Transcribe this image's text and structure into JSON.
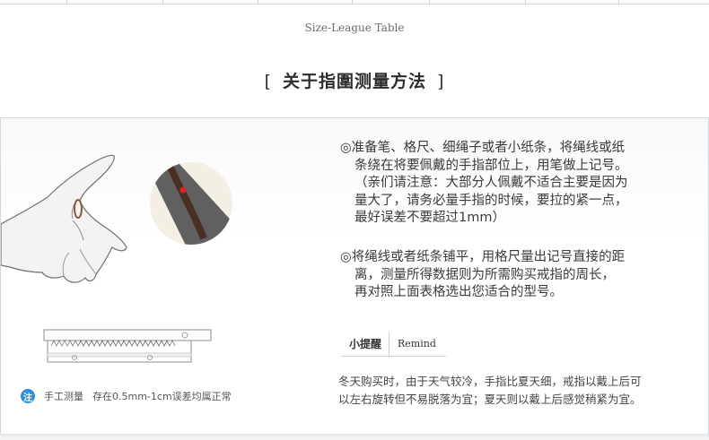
{
  "size_table": {
    "caption": "Size-League Table"
  },
  "section": {
    "bracket_open": "[",
    "title": "关于指圍测量方法",
    "bracket_close": "]"
  },
  "instructions": {
    "step1_lines": [
      "◎准备笔、格尺、细绳子或者小纸条，将绳线或纸",
      "条绕在将要佩戴的手指部位上，用笔做上记号。",
      "（亲们请注意：大部分人佩戴不适合主要是因为",
      "量大了，请务必量手指的时候，要拉的紧一点，",
      "最好误差不要超过1mm）"
    ],
    "step2_lines": [
      "◎将绳线或者纸条铺平，用格尺量出记号直接的距",
      "离，测量所得数据则为所需购买戒指的周长，",
      "再对照上面表格选出您适合的型号。"
    ]
  },
  "tip": {
    "label_zh": "小提醒",
    "label_en": "Remind",
    "note_lines": [
      "冬天购买时，由于天气较冷，手指比夏天细，戒指以戴上后可",
      "以左右旋转但不易脱落为宜；夏天则以戴上后感觉稍紧为宜。"
    ]
  },
  "footnote": {
    "badge": "注",
    "label": "手工测量",
    "text": "存在0.5mm-1cm误差均属正常"
  },
  "colors": {
    "accent_blue": "#2f8fd8",
    "panel_border": "#cfd6df",
    "marker_red": "#d9252a",
    "strap_brown": "#4a2f24"
  },
  "icons": {
    "hand": "hand-illustration-icon",
    "finger_closeup": "finger-wrap-closeup-icon",
    "ruler": "ruler-icon",
    "badge": "note-badge-icon"
  }
}
